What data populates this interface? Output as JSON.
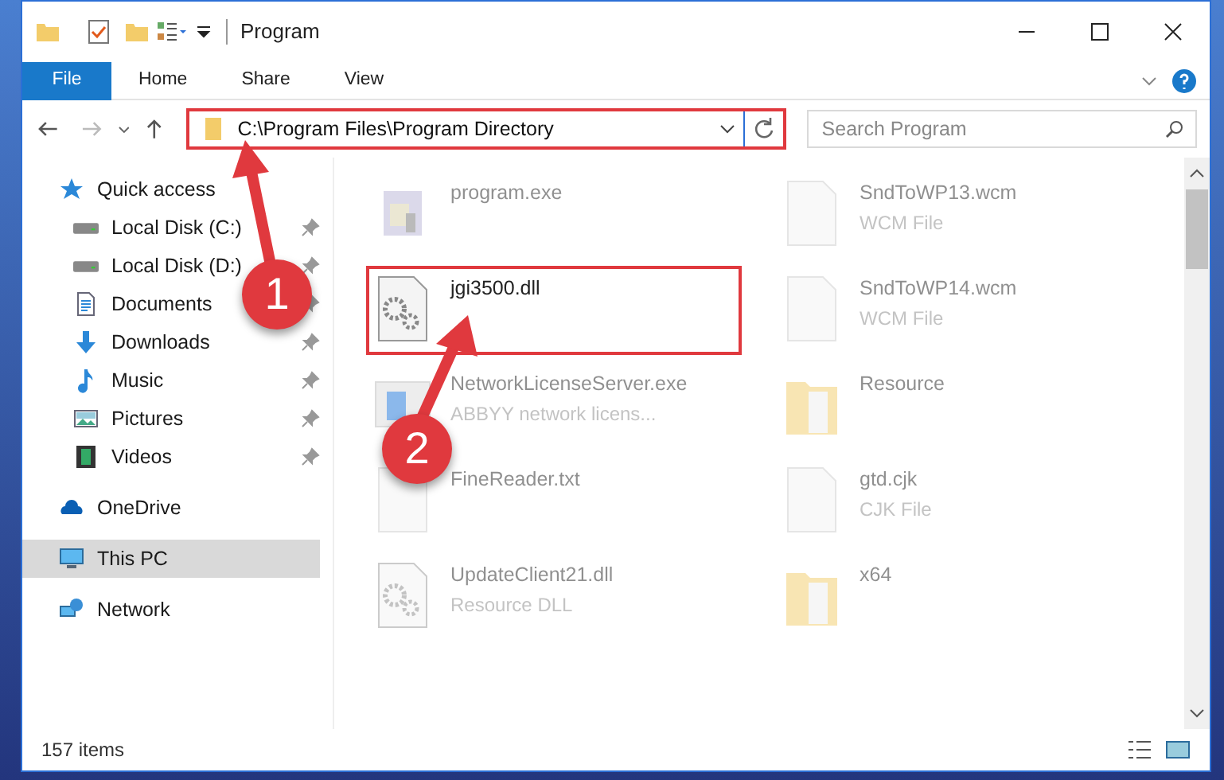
{
  "window": {
    "title": "Program"
  },
  "ribbon_tabs": [
    {
      "label": "File",
      "selected": true
    },
    {
      "label": "Home",
      "selected": false
    },
    {
      "label": "Share",
      "selected": false
    },
    {
      "label": "View",
      "selected": false
    }
  ],
  "address": {
    "path": "C:\\Program Files\\Program Directory",
    "highlighted": true
  },
  "search": {
    "placeholder": "Search Program"
  },
  "sidebar": {
    "items": [
      {
        "label": "Quick access",
        "kind": "star",
        "selected": false,
        "children": [
          {
            "label": "Local Disk (C:)",
            "kind": "disk",
            "pinned": true,
            "selected": false
          },
          {
            "label": "Local Disk (D:)",
            "kind": "disk",
            "pinned": true,
            "selected": false
          },
          {
            "label": "Documents",
            "kind": "document",
            "pinned": true,
            "selected": false
          },
          {
            "label": "Downloads",
            "kind": "download",
            "pinned": true,
            "selected": false
          },
          {
            "label": "Music",
            "kind": "music",
            "pinned": true,
            "selected": false
          },
          {
            "label": "Pictures",
            "kind": "pictures",
            "pinned": true,
            "selected": false
          },
          {
            "label": "Videos",
            "kind": "video",
            "pinned": true,
            "selected": false
          }
        ]
      },
      {
        "label": "OneDrive",
        "kind": "cloud",
        "selected": false
      },
      {
        "label": "This PC",
        "kind": "pc",
        "selected": true
      },
      {
        "label": "Network",
        "kind": "network",
        "selected": false
      }
    ]
  },
  "files": [
    {
      "name": "program.exe",
      "kind": "app",
      "blurred": true,
      "highlighted": false
    },
    {
      "name": "SndToWP13.wcm",
      "type": "WCM File",
      "kind": "blank",
      "blurred": true,
      "highlighted": false
    },
    {
      "name": "jgi3500.dll",
      "kind": "dll",
      "blurred": false,
      "highlighted": true
    },
    {
      "name": "SndToWP14.wcm",
      "type": "WCM File",
      "kind": "blank",
      "blurred": true,
      "highlighted": false
    },
    {
      "name": "NetworkLicenseServer.exe",
      "type": "ABBYY network licens...",
      "kind": "window",
      "blurred": true,
      "highlighted": false
    },
    {
      "name": "Resource",
      "kind": "folder",
      "blurred": true,
      "highlighted": false
    },
    {
      "name": "FineReader.txt",
      "kind": "blank",
      "blurred": true,
      "highlighted": false
    },
    {
      "name": "gtd.cjk",
      "type": "CJK File",
      "kind": "blank",
      "blurred": true,
      "highlighted": false
    },
    {
      "name": "UpdateClient21.dll",
      "type": "Resource DLL",
      "kind": "dll",
      "blurred": true,
      "highlighted": false
    },
    {
      "name": "x64",
      "kind": "folder",
      "blurred": true,
      "highlighted": false
    }
  ],
  "callouts": [
    "1",
    "2"
  ],
  "status_bar": {
    "count": "157 items"
  }
}
